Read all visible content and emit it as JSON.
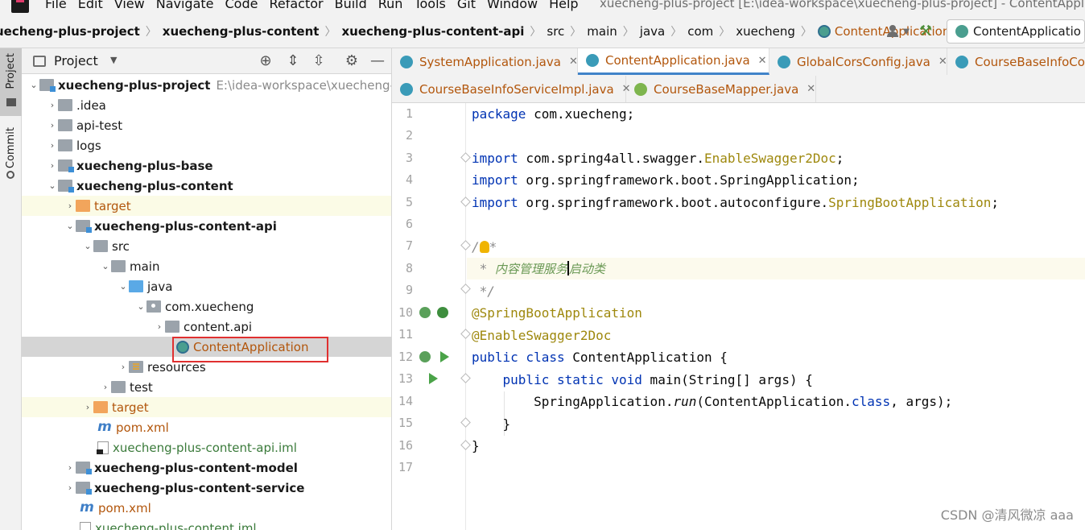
{
  "menubar": {
    "items": [
      "File",
      "Edit",
      "View",
      "Navigate",
      "Code",
      "Refactor",
      "Build",
      "Run",
      "Tools",
      "Git",
      "Window",
      "Help"
    ],
    "window_title": "xuecheng-plus-project [E:\\idea-workspace\\xuecheng-plus-project] - ContentApplic"
  },
  "breadcrumb": {
    "items": [
      "uecheng-plus-project",
      "xuecheng-plus-content",
      "xuecheng-plus-content-api",
      "src",
      "main",
      "java",
      "com",
      "xuecheng",
      "ContentApplication"
    ]
  },
  "run_config": {
    "label": "ContentApplicatio"
  },
  "tool_strip": {
    "project_label": "Project",
    "commit_label": "Commit"
  },
  "project_panel": {
    "title": "Project",
    "tree": [
      {
        "label": "xuecheng-plus-project",
        "path": "E:\\idea-workspace\\xuecheng-p"
      },
      {
        "label": ".idea"
      },
      {
        "label": "api-test"
      },
      {
        "label": "logs"
      },
      {
        "label": "xuecheng-plus-base"
      },
      {
        "label": "xuecheng-plus-content"
      },
      {
        "label": "target"
      },
      {
        "label": "xuecheng-plus-content-api"
      },
      {
        "label": "src"
      },
      {
        "label": "main"
      },
      {
        "label": "java"
      },
      {
        "label": "com.xuecheng"
      },
      {
        "label": "content.api"
      },
      {
        "label": "ContentApplication"
      },
      {
        "label": "resources"
      },
      {
        "label": "test"
      },
      {
        "label": "target"
      },
      {
        "label": "pom.xml"
      },
      {
        "label": "xuecheng-plus-content-api.iml"
      },
      {
        "label": "xuecheng-plus-content-model"
      },
      {
        "label": "xuecheng-plus-content-service"
      },
      {
        "label": "pom.xml"
      },
      {
        "label": "xuecheng-plus-content.iml"
      }
    ]
  },
  "tabs": {
    "row1": [
      "SystemApplication.java",
      "ContentApplication.java",
      "GlobalCorsConfig.java",
      "CourseBaseInfoCon"
    ],
    "row2": [
      "CourseBaseInfoServiceImpl.java",
      "CourseBaseMapper.java"
    ]
  },
  "editor": {
    "line_numbers": [
      "1",
      "2",
      "3",
      "4",
      "5",
      "6",
      "7",
      "8",
      "9",
      "10",
      "11",
      "12",
      "13",
      "14",
      "15",
      "16",
      "17"
    ],
    "code": {
      "l1_kw": "package",
      "l1_rest": " com.xuecheng;",
      "l3_kw": "import",
      "l3_pkg": " com.spring4all.swagger.",
      "l3_cls": "EnableSwagger2Doc",
      "l3_end": ";",
      "l4_kw": "import",
      "l4_rest": " org.springframework.boot.SpringApplication;",
      "l5_kw": "import",
      "l5_pkg": " org.springframework.boot.autoconfigure.",
      "l5_cls": "SpringBootApplication",
      "l5_end": ";",
      "l7_a": "/",
      "l7_b": "*",
      "l8_a": " * ",
      "l8_b": "内容管理服务",
      "l8_c": "启动类",
      "l9": " */",
      "l10": "@SpringBootApplication",
      "l11": "@EnableSwagger2Doc",
      "l12_kw": "public class",
      "l12_rest": " ContentApplication {",
      "l13_indent": "    ",
      "l13_kw": "public static void",
      "l13_rest": " main(String[] args) {",
      "l14_indent": "        ",
      "l14_a": "SpringApplication.",
      "l14_run": "run",
      "l14_b": "(ContentApplication.",
      "l14_kw": "class",
      "l14_c": ", args);",
      "l15": "    }",
      "l16": "}"
    }
  },
  "watermark": "CSDN @清风微凉 aaa"
}
